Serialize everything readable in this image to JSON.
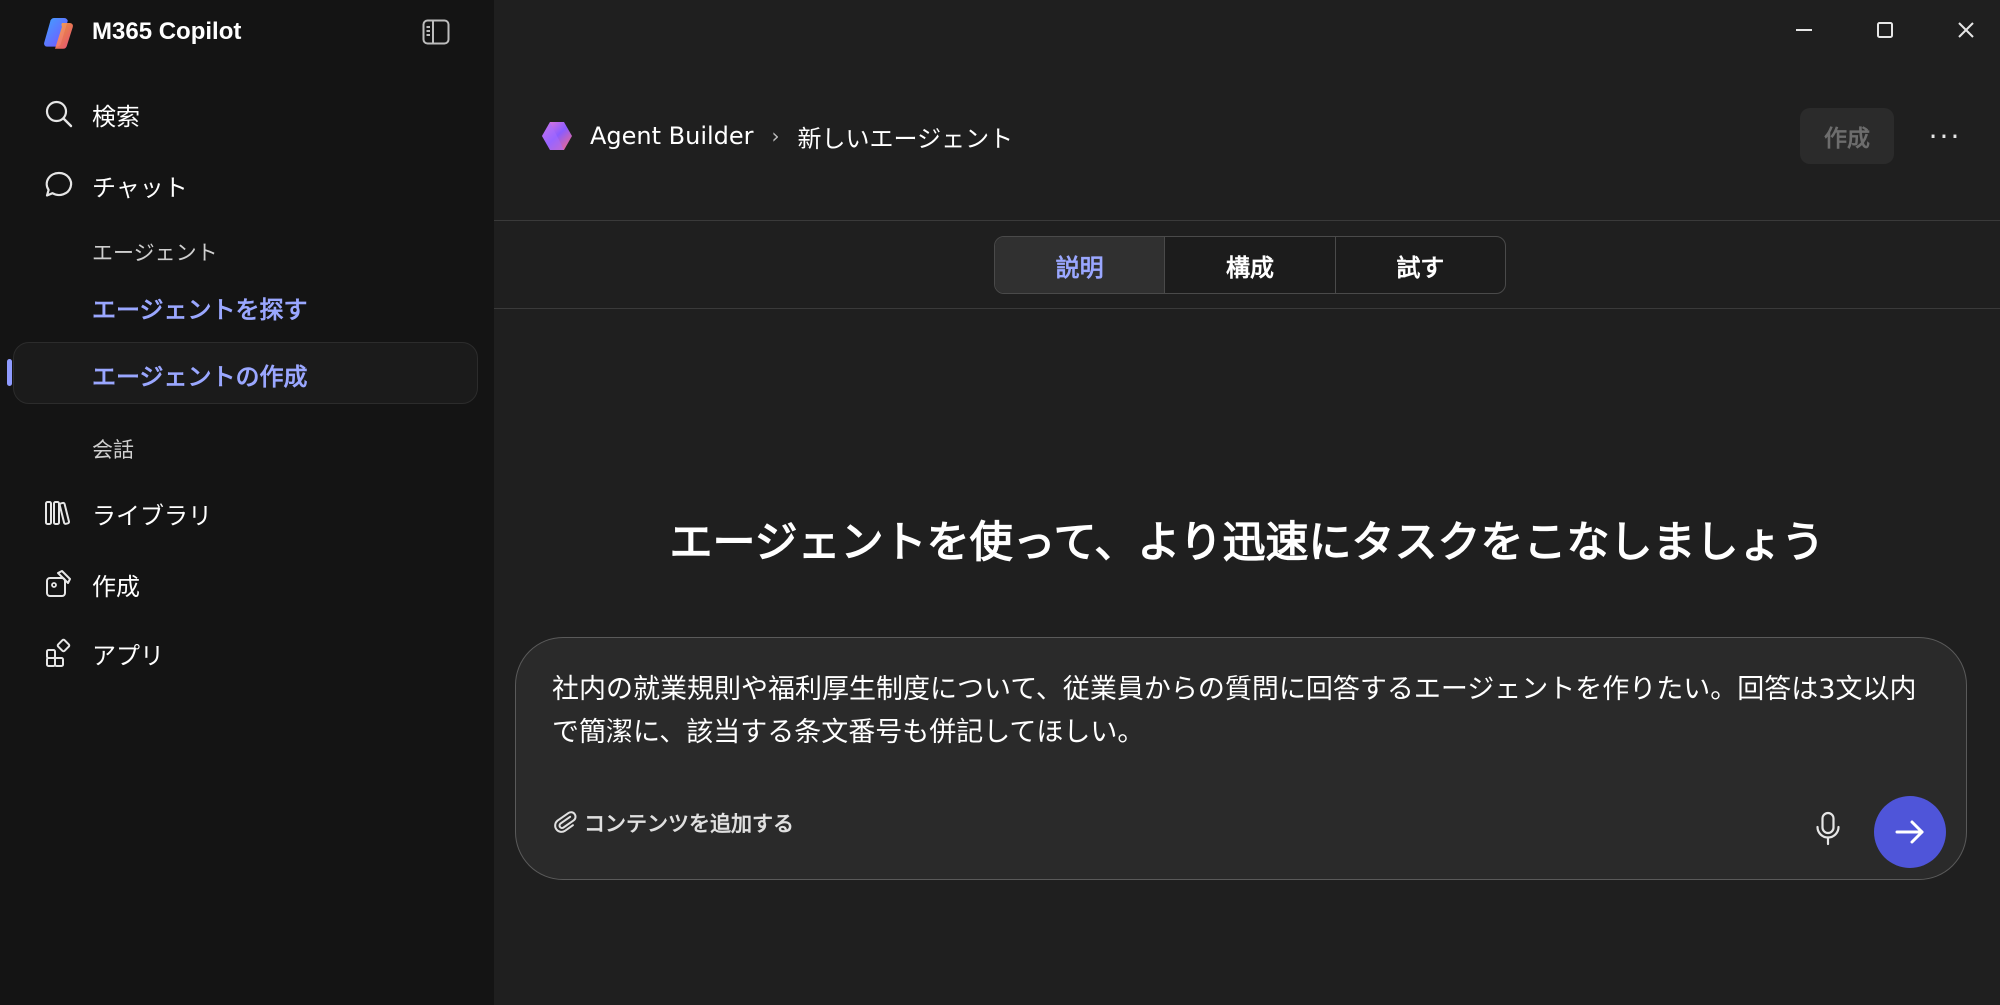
{
  "app": {
    "title": "M365 Copilot"
  },
  "sidebar": {
    "nav": [
      {
        "label": "検索",
        "icon": "search-icon"
      },
      {
        "label": "チャット",
        "icon": "chat-icon"
      },
      {
        "label": "ライブラリ",
        "icon": "library-icon"
      },
      {
        "label": "作成",
        "icon": "create-icon"
      },
      {
        "label": "アプリ",
        "icon": "apps-icon"
      }
    ],
    "agents_section_label": "エージェント",
    "find_agents_label": "エージェントを探す",
    "create_agent_label": "エージェントの作成",
    "conversations_section_label": "会話"
  },
  "header": {
    "product": "Agent Builder",
    "page": "新しいエージェント",
    "create_button": "作成",
    "more_button": "···"
  },
  "tabs": [
    {
      "label": "説明",
      "active": true
    },
    {
      "label": "構成",
      "active": false
    },
    {
      "label": "試す",
      "active": false
    }
  ],
  "hero": {
    "title": "エージェントを使って、より迅速にタスクをこなしましょう"
  },
  "prompt": {
    "text": "社内の就業規則や福利厚生制度について、従業員からの質問に回答するエージェントを作りたい。回答は3文以内で簡潔に、該当する条文番号も併記してほしい。",
    "attach_label": "コンテンツを追加する"
  },
  "colors": {
    "accent": "#9aa7ff",
    "send_button": "#4f55d9",
    "sidebar_bg": "#141414",
    "main_bg": "#1f1f1f"
  }
}
